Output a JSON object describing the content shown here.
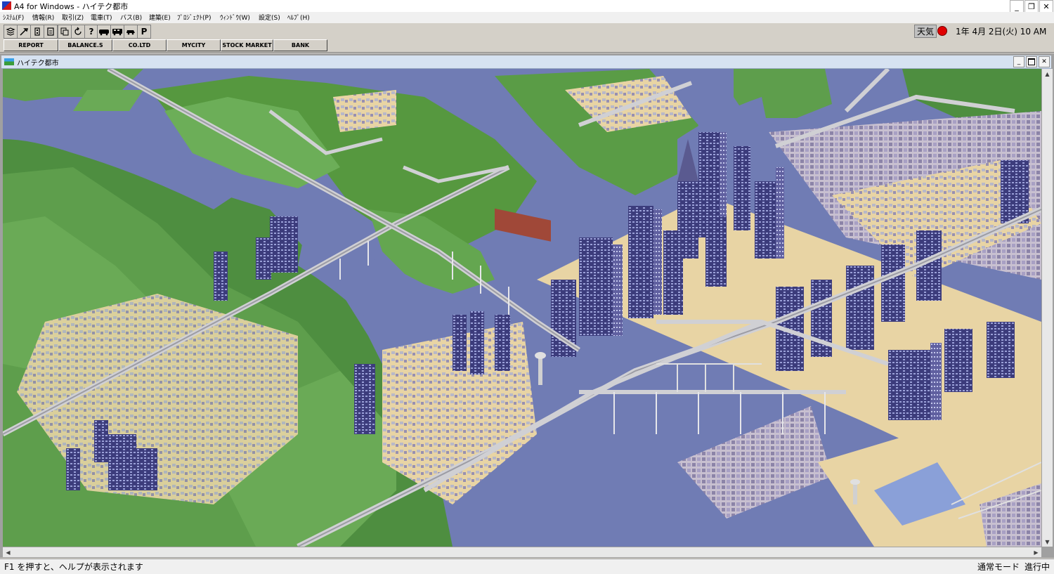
{
  "window": {
    "title": "A4 for Windows - ハイテク都市",
    "minimize_glyph": "_",
    "restore_glyph": "❐",
    "close_glyph": "✕"
  },
  "menu": [
    "ｼｽﾃﾑ(F)",
    "情報(R)",
    "取引(Z)",
    "電車(T)",
    "バス(B)",
    "建築(E)",
    "ﾌﾟﾛｼﾞｪｸﾄ(P)",
    "ｳｨﾝﾄﾞｳ(W)",
    "設定(S)",
    "ﾍﾙﾌﾟ(H)"
  ],
  "toolbar": {
    "group1_icons": [
      "layers-icon",
      "tool-icon",
      "building-icon",
      "document-icon"
    ],
    "group2_icons": [
      "copy-icon",
      "refresh-icon",
      "help-icon"
    ],
    "help_glyph": "?",
    "group3_icons": [
      "train-icon",
      "bus-icon",
      "car-icon"
    ],
    "parking_label": "P"
  },
  "status_top": {
    "weather_label": "天気",
    "weather_color": "#e00000",
    "datetime": "1年 4月 2日(火) 10 AM"
  },
  "nav_buttons": [
    "REPORT",
    "BALANCE.S",
    "CO.LTD",
    "MYCITY",
    "STOCK MARKET",
    "BANK"
  ],
  "child_window": {
    "title": "ハイテク都市"
  },
  "statusbar": {
    "help": "F1 を押すと、ヘルプが表示されます",
    "mode": "通常モード",
    "state": "進行中"
  },
  "colors": {
    "water": "#707cb4",
    "grass": "#5a9a48",
    "sand": "#e8d4a4",
    "road": "#c8c8c8",
    "building": "#3a3a78"
  }
}
